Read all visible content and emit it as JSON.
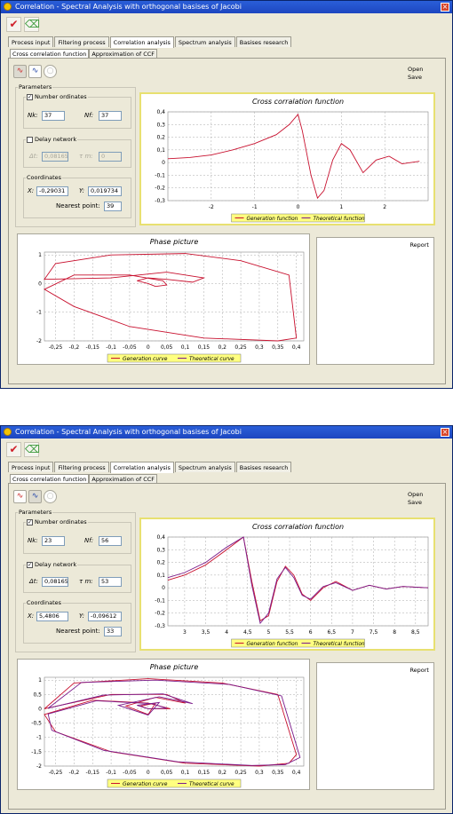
{
  "window": {
    "title": "Correlation - Spectral Analysis with orthogonal basises of Jacobi",
    "close_glyph": "×"
  },
  "toolbar": {
    "ok_icon": "checkmark-icon",
    "cancel_icon": "eraser-icon"
  },
  "tabs": [
    "Process input",
    "Filtering process",
    "Correlation analysis",
    "Spectrum analysis",
    "Basises research"
  ],
  "active_tab": "Correlation analysis",
  "subtabs": [
    "Cross correlation function",
    "Approximation of CCF"
  ],
  "active_subtab": "Cross correlation function",
  "actions": {
    "open": "Open",
    "save": "Save"
  },
  "colors": {
    "generation": "#c8102e",
    "theoretical": "#7a1a8a",
    "accent_frame": "#e8e070",
    "legend_bg": "#ffff80"
  },
  "panels": [
    {
      "params": {
        "title": "Parameters",
        "number_ordinates": {
          "label": "Number ordinates",
          "checked": "✓",
          "nk_label": "Nk:",
          "nk": "37",
          "nf_label": "Nf:",
          "nf": "37"
        },
        "delay_network": {
          "label": "Delay network",
          "checked": "",
          "dt_label": "Δt:",
          "dt": "0,08165",
          "tau_label": "τ m:",
          "tau": "0",
          "disabled": true
        },
        "coordinates": {
          "label": "Coordinates",
          "x_label": "X:",
          "x": "-0,29031",
          "y_label": "Y:",
          "y": "0,019734",
          "nearest_label": "Nearest point:",
          "nearest": "39"
        }
      },
      "report_label": "Report",
      "chart_data": [
        {
          "type": "line",
          "title": "Cross corralation function",
          "xlim": [
            -3,
            3
          ],
          "ylim": [
            -0.3,
            0.4
          ],
          "xticks": [
            -2,
            -1,
            0,
            1,
            2
          ],
          "yticks": [
            0.4,
            0.3,
            0.2,
            0.1,
            0,
            -0.1,
            -0.2,
            -0.3
          ],
          "ytick_labels": [
            "0,4",
            "0,3",
            "0,2",
            "0,1",
            "0",
            "-0,1",
            "-0,2",
            "-0,3"
          ],
          "legend": "bottom",
          "series": [
            {
              "name": "Generation function",
              "x": [
                -3,
                -2.5,
                -2,
                -1.5,
                -1,
                -0.5,
                -0.2,
                0,
                0.1,
                0.3,
                0.45,
                0.6,
                0.8,
                1.0,
                1.2,
                1.5,
                1.8,
                2.1,
                2.4,
                2.8
              ],
              "y": [
                0.03,
                0.04,
                0.06,
                0.1,
                0.15,
                0.22,
                0.3,
                0.38,
                0.25,
                -0.1,
                -0.28,
                -0.22,
                0.02,
                0.15,
                0.1,
                -0.08,
                0.02,
                0.05,
                -0.01,
                0.01
              ]
            },
            {
              "name": "Theoretical function",
              "x": [],
              "y": []
            }
          ]
        },
        {
          "type": "line",
          "title": "Phase picture",
          "xlim": [
            -0.28,
            0.42
          ],
          "ylim": [
            -2,
            1.1
          ],
          "xticks": [
            -0.25,
            -0.2,
            -0.15,
            -0.1,
            -0.05,
            0,
            0.05,
            0.1,
            0.15,
            0.2,
            0.25,
            0.3,
            0.35,
            0.4
          ],
          "xtick_labels": [
            "-0,25",
            "-0,2",
            "-0,15",
            "-0,1",
            "-0,05",
            "0",
            "0,05",
            "0,1",
            "0,15",
            "0,2",
            "0,25",
            "0,3",
            "0,35",
            "0,4"
          ],
          "yticks": [
            1,
            0,
            -1,
            -2
          ],
          "legend": "bottom",
          "series": [
            {
              "name": "Generation curve",
              "x": [
                0.02,
                0.0,
                -0.03,
                0.0,
                0.05,
                0.12,
                0.15,
                0.05,
                -0.1,
                -0.28,
                -0.25,
                -0.1,
                0.1,
                0.25,
                0.38,
                0.4,
                0.35,
                0.15,
                -0.05,
                -0.2,
                -0.28,
                -0.2,
                -0.05,
                0.04,
                0.05,
                0.02
              ],
              "y": [
                -0.1,
                0.0,
                0.1,
                0.2,
                0.15,
                0.05,
                0.2,
                0.4,
                0.2,
                0.15,
                0.7,
                1.0,
                1.05,
                0.8,
                0.3,
                -1.9,
                -2.0,
                -1.9,
                -1.5,
                -0.8,
                -0.2,
                0.3,
                0.3,
                0.1,
                -0.05,
                -0.1
              ]
            },
            {
              "name": "Theoretical curve",
              "x": [],
              "y": []
            }
          ]
        }
      ]
    },
    {
      "params": {
        "title": "Parameters",
        "number_ordinates": {
          "label": "Number ordinates",
          "checked": "✓",
          "nk_label": "Nk:",
          "nk": "23",
          "nf_label": "Nf:",
          "nf": "56"
        },
        "delay_network": {
          "label": "Delay network",
          "checked": "✓",
          "dt_label": "Δt:",
          "dt": "0,08165",
          "tau_label": "τ m:",
          "tau": "53",
          "disabled": false
        },
        "coordinates": {
          "label": "Coordinates",
          "x_label": "X:",
          "x": "5,4806",
          "y_label": "Y:",
          "y": "-0,09612",
          "nearest_label": "Nearest point:",
          "nearest": "33"
        }
      },
      "report_label": "Report",
      "chart_data": [
        {
          "type": "line",
          "title": "Cross corralation function",
          "xlim": [
            2.6,
            8.8
          ],
          "ylim": [
            -0.3,
            0.4
          ],
          "xticks": [
            3,
            3.5,
            4,
            4.5,
            5,
            5.5,
            6,
            6.5,
            7,
            7.5,
            8,
            8.5
          ],
          "xtick_labels": [
            "3",
            "3,5",
            "4",
            "4,5",
            "5",
            "5,5",
            "6",
            "6,5",
            "7",
            "7,5",
            "8",
            "8,5"
          ],
          "yticks": [
            0.4,
            0.3,
            0.2,
            0.1,
            0,
            -0.1,
            -0.2,
            -0.3
          ],
          "ytick_labels": [
            "0,4",
            "0,3",
            "0,2",
            "0,1",
            "0",
            "-0,1",
            "-0,2",
            "-0,3"
          ],
          "legend": "bottom",
          "series": [
            {
              "name": "Generation function",
              "x": [
                2.6,
                3.0,
                3.5,
                4.0,
                4.4,
                4.6,
                4.8,
                5.0,
                5.2,
                5.4,
                5.6,
                5.8,
                6.0,
                6.3,
                6.6,
                7.0,
                7.4,
                7.8,
                8.2,
                8.8
              ],
              "y": [
                0.06,
                0.1,
                0.18,
                0.3,
                0.4,
                0.05,
                -0.26,
                -0.22,
                0.05,
                0.17,
                0.1,
                -0.05,
                -0.1,
                0.0,
                0.05,
                -0.02,
                0.02,
                -0.01,
                0.01,
                0.0
              ]
            },
            {
              "name": "Theoretical function",
              "x": [
                2.6,
                3.0,
                3.5,
                4.0,
                4.4,
                4.6,
                4.8,
                5.0,
                5.2,
                5.4,
                5.6,
                5.8,
                6.0,
                6.3,
                6.6,
                7.0,
                7.4,
                7.8,
                8.2,
                8.8
              ],
              "y": [
                0.08,
                0.12,
                0.2,
                0.32,
                0.4,
                0.02,
                -0.28,
                -0.2,
                0.07,
                0.16,
                0.08,
                -0.06,
                -0.09,
                0.01,
                0.04,
                -0.02,
                0.02,
                -0.01,
                0.01,
                0.0
              ]
            }
          ]
        },
        {
          "type": "line",
          "title": "Phase picture",
          "xlim": [
            -0.28,
            0.42
          ],
          "ylim": [
            -2,
            1.1
          ],
          "xticks": [
            -0.25,
            -0.2,
            -0.15,
            -0.1,
            -0.05,
            0,
            0.05,
            0.1,
            0.15,
            0.2,
            0.25,
            0.3,
            0.35,
            0.4
          ],
          "xtick_labels": [
            "-0,25",
            "-0,2",
            "-0,15",
            "-0,1",
            "-0,05",
            "0",
            "0,05",
            "0,1",
            "0,15",
            "0,2",
            "0,25",
            "0,3",
            "0,35",
            "0,4"
          ],
          "yticks": [
            1,
            0.5,
            0,
            -0.5,
            -1,
            -1.5,
            -2
          ],
          "ytick_labels": [
            "1",
            "0,5",
            "0",
            "-0,5",
            "-1",
            "-1,5",
            "-2"
          ],
          "legend": "bottom",
          "series": [
            {
              "name": "Generation curve",
              "x": [
                0.0,
                -0.02,
                0.02,
                0.0,
                -0.06,
                0.02,
                0.1,
                0.05,
                -0.1,
                -0.28,
                -0.2,
                0.0,
                0.2,
                0.35,
                0.4,
                0.38,
                0.3,
                0.1,
                -0.1,
                -0.25,
                -0.28,
                -0.15,
                0.0,
                0.06,
                0.0
              ],
              "y": [
                0.0,
                0.1,
                0.2,
                -0.2,
                0.1,
                0.4,
                0.2,
                0.5,
                0.5,
                0.0,
                0.9,
                1.05,
                0.9,
                0.5,
                -1.6,
                -1.9,
                -2.0,
                -1.9,
                -1.5,
                -0.8,
                -0.2,
                0.3,
                0.2,
                0.0,
                0.0
              ]
            },
            {
              "name": "Theoretical curve",
              "x": [
                0.0,
                -0.03,
                0.03,
                0.0,
                -0.08,
                0.03,
                0.12,
                0.04,
                -0.12,
                -0.27,
                -0.18,
                0.02,
                0.22,
                0.36,
                0.41,
                0.37,
                0.28,
                0.08,
                -0.12,
                -0.26,
                -0.27,
                -0.14,
                0.01,
                0.05,
                0.0
              ],
              "y": [
                0.0,
                0.12,
                0.22,
                -0.22,
                0.12,
                0.42,
                0.18,
                0.52,
                0.48,
                0.02,
                0.92,
                1.0,
                0.85,
                0.45,
                -1.7,
                -1.95,
                -1.98,
                -1.85,
                -1.45,
                -0.75,
                -0.18,
                0.28,
                0.18,
                0.02,
                0.0
              ]
            }
          ]
        }
      ]
    }
  ]
}
